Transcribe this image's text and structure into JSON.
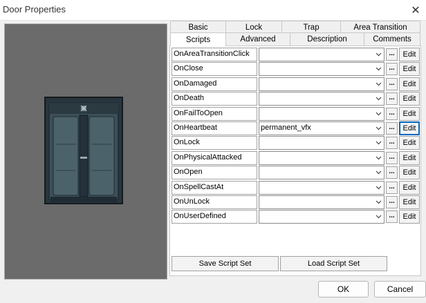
{
  "window": {
    "title": "Door Properties",
    "close_glyph": "✕"
  },
  "tabs_back": [
    "Basic",
    "Lock",
    "Trap",
    "Area Transition"
  ],
  "tabs_front": [
    "Scripts",
    "Advanced",
    "Description",
    "Comments"
  ],
  "active_tab": "Scripts",
  "scripts": [
    {
      "event": "OnAreaTransitionClick",
      "value": ""
    },
    {
      "event": "OnClose",
      "value": ""
    },
    {
      "event": "OnDamaged",
      "value": ""
    },
    {
      "event": "OnDeath",
      "value": ""
    },
    {
      "event": "OnFailToOpen",
      "value": ""
    },
    {
      "event": "OnHeartbeat",
      "value": "permanent_vfx"
    },
    {
      "event": "OnLock",
      "value": ""
    },
    {
      "event": "OnPhysicalAttacked",
      "value": ""
    },
    {
      "event": "OnOpen",
      "value": ""
    },
    {
      "event": "OnSpellCastAt",
      "value": ""
    },
    {
      "event": "OnUnLock",
      "value": ""
    },
    {
      "event": "OnUserDefined",
      "value": ""
    }
  ],
  "row_buttons": {
    "browse_label": "...",
    "edit_label": "Edit"
  },
  "script_set": {
    "save_label": "Save Script Set",
    "load_label": "Load Script Set"
  },
  "dialog": {
    "ok_label": "OK",
    "cancel_label": "Cancel"
  },
  "colors": {
    "preview_bg": "#6b6b6b",
    "focus_border": "#0067c0",
    "door_metal": "#3d4f58"
  },
  "icons": {
    "combo_arrow": "chevron-down-icon",
    "close": "close-icon",
    "preview": "door-model-icon"
  }
}
